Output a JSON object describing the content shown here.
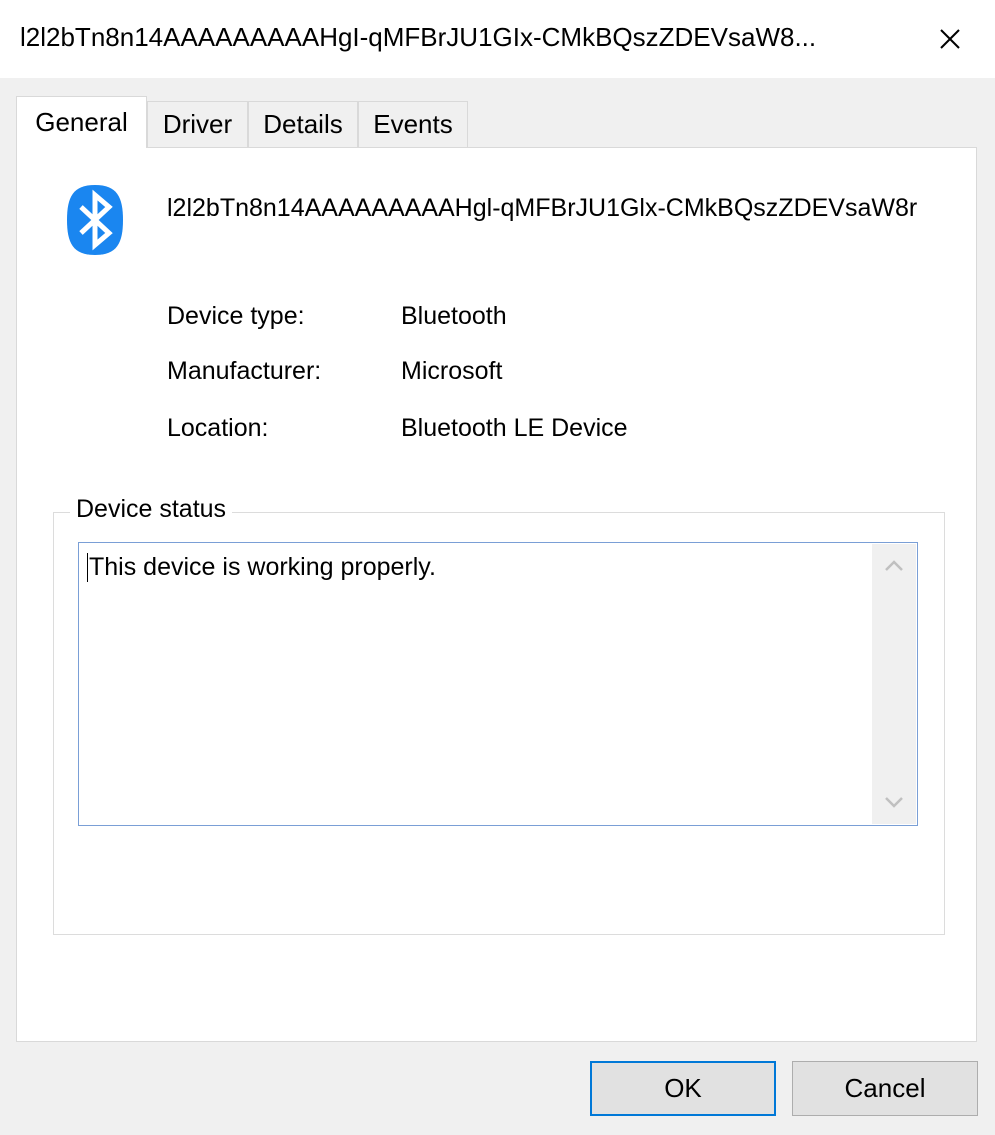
{
  "window": {
    "title": "l2l2bTn8n14AAAAAAAAAHgI-qMFBrJU1GIx-CMkBQszZDEVsaW8..."
  },
  "tabs": [
    {
      "label": "General",
      "active": true
    },
    {
      "label": "Driver",
      "active": false
    },
    {
      "label": "Details",
      "active": false
    },
    {
      "label": "Events",
      "active": false
    }
  ],
  "device": {
    "icon": "bluetooth-icon",
    "name": "l2l2bTn8n14AAAAAAAAAHgl-qMFBrJU1Glx-CMkBQszZDEVsaW8r"
  },
  "properties": [
    {
      "label": "Device type:",
      "value": "Bluetooth"
    },
    {
      "label": "Manufacturer:",
      "value": "Microsoft"
    },
    {
      "label": "Location:",
      "value": "Bluetooth LE Device"
    }
  ],
  "status": {
    "group_label": "Device status",
    "text": "This device is working properly."
  },
  "buttons": {
    "ok": "OK",
    "cancel": "Cancel"
  },
  "colors": {
    "bluetooth_blue": "#1a86f0",
    "default_button_border": "#0078d7"
  }
}
